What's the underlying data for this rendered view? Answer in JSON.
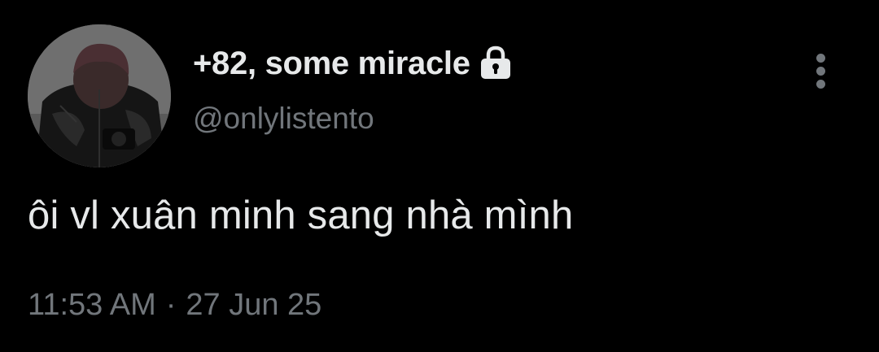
{
  "tweet": {
    "author": {
      "display_name": "+82, some miracle",
      "handle": "@onlylistento",
      "protected_icon": "lock-icon",
      "avatar_icon": "profile-photo"
    },
    "more_icon": "vertical-ellipsis-icon",
    "text": "ôi vl xuân minh sang nhà mình",
    "time": "11:53 AM",
    "separator": "·",
    "date": "27 Jun 25"
  },
  "colors": {
    "background": "#000000",
    "primary_text": "#e7e9ea",
    "secondary_text": "#71767b"
  }
}
